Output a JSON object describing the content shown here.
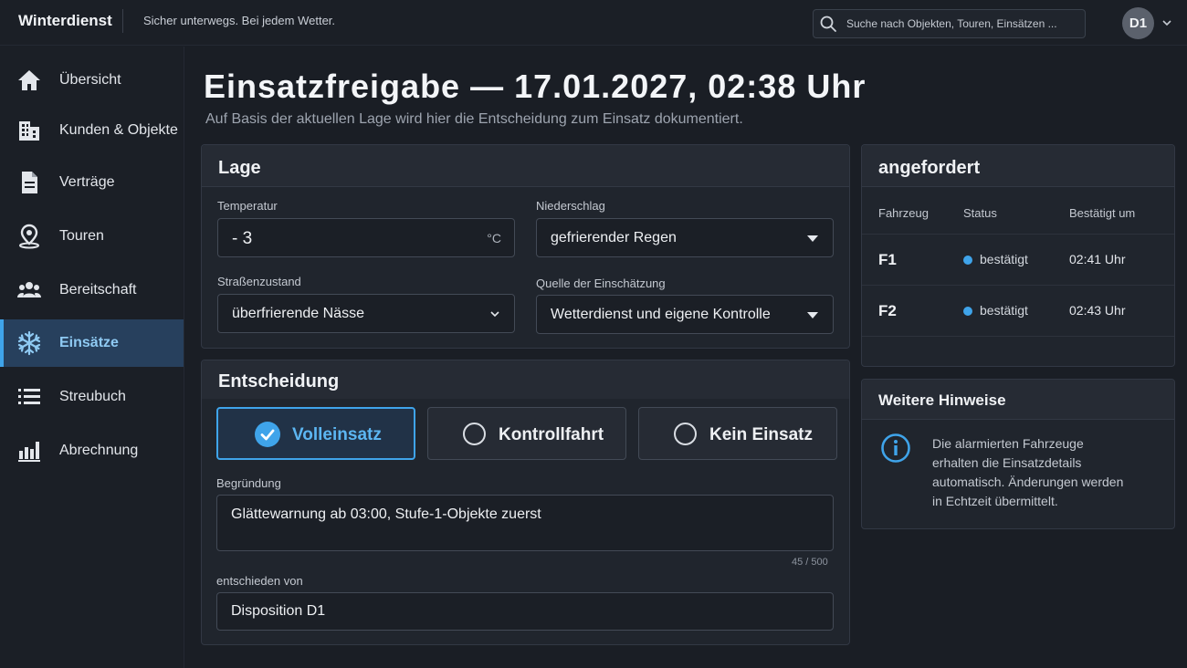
{
  "app": {
    "brand": "Winterdienst",
    "tagline": "Sicher unterwegs. Bei jedem Wetter."
  },
  "search": {
    "placeholder": "Suche nach Objekten, Touren, Einsätzen ..."
  },
  "user": {
    "initials": "D1"
  },
  "sidebar": {
    "items": [
      {
        "label": "Übersicht",
        "icon": "home-icon"
      },
      {
        "label": "Kunden & Objekte",
        "icon": "building-icon"
      },
      {
        "label": "Verträge",
        "icon": "document-icon"
      },
      {
        "label": "Touren",
        "icon": "map-pin-icon"
      },
      {
        "label": "Bereitschaft",
        "icon": "team-icon"
      },
      {
        "label": "Einsätze",
        "icon": "snowflake-icon",
        "active": true
      },
      {
        "label": "Streubuch",
        "icon": "list-icon"
      },
      {
        "label": "Abrechnung",
        "icon": "bar-chart-icon"
      }
    ]
  },
  "page": {
    "title": "Einsatzfreigabe — 17.01.2027, 02:38 Uhr",
    "subtitle": "Auf Basis der aktuellen Lage wird hier die Entscheidung zum Einsatz dokumentiert."
  },
  "lage": {
    "title": "Lage",
    "temperature": {
      "label": "Temperatur",
      "value": "- 3",
      "unit": "°C"
    },
    "precipitation": {
      "label": "Niederschlag",
      "value": "gefrierender Regen"
    },
    "road": {
      "label": "Straßenzustand",
      "value": "überfrierende Nässe"
    },
    "source": {
      "label": "Quelle der Einschätzung",
      "value": "Wetterdienst und eigene Kontrolle"
    }
  },
  "decision": {
    "title": "Entscheidung",
    "options": [
      {
        "label": "Volleinsatz",
        "selected": true
      },
      {
        "label": "Kontrollfahrt",
        "selected": false
      },
      {
        "label": "Kein Einsatz",
        "selected": false
      }
    ],
    "reason": {
      "label": "Begründung",
      "value": "Glättewarnung ab 03:00, Stufe-1-Objekte zuerst",
      "counter": "45 / 500"
    },
    "decided_by": {
      "label": "entschieden von",
      "value": "Disposition D1"
    }
  },
  "requested": {
    "title": "angefordert",
    "columns": [
      "Fahrzeug",
      "Status",
      "Bestätigt um"
    ],
    "rows": [
      {
        "vehicle": "F1",
        "status": "bestätigt",
        "time": "02:41 Uhr"
      },
      {
        "vehicle": "F2",
        "status": "bestätigt",
        "time": "02:43 Uhr"
      }
    ]
  },
  "hints": {
    "title": "Weitere Hinweise",
    "text": "Die alarmierten Fahrzeuge erhalten die Einsatzdetails automatisch. Änderungen werden in Echtzeit übermittelt."
  },
  "colors": {
    "accent": "#3fa4ea",
    "background": "#1a1e25",
    "card": "#20252d"
  }
}
